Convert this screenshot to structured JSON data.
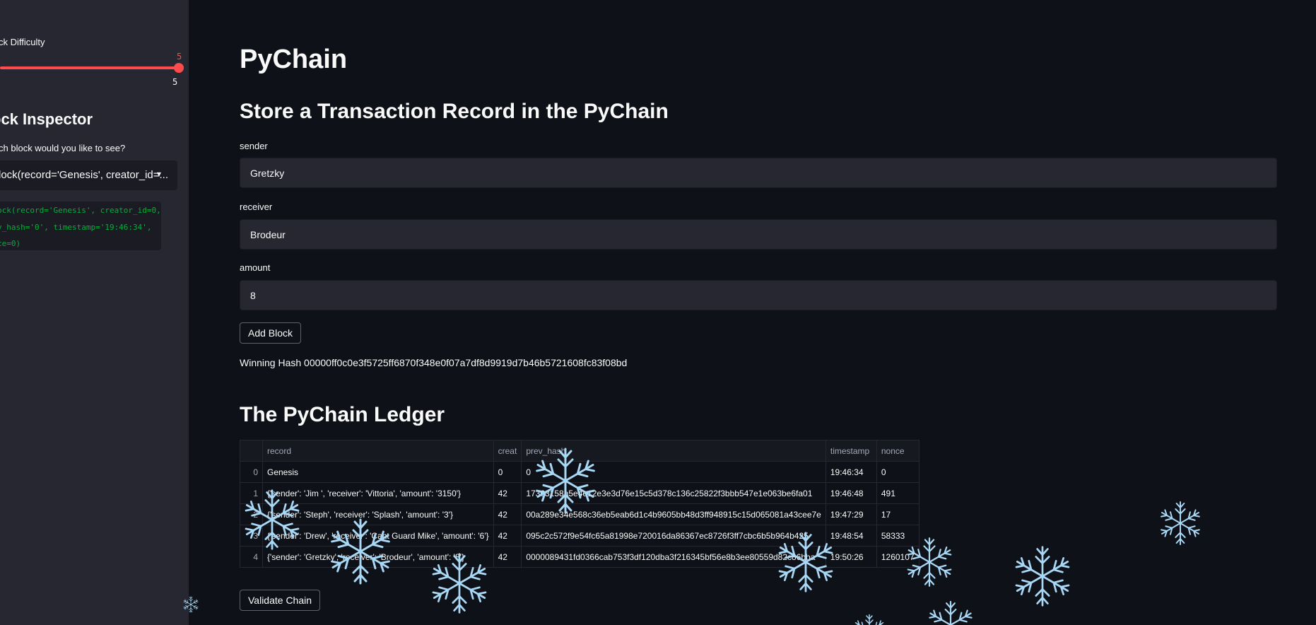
{
  "sidebar": {
    "difficulty_label": "ck Difficulty",
    "difficulty_value": "5",
    "difficulty_max": "5",
    "difficulty_fraction": 1.0,
    "inspector_heading": "ock Inspector",
    "inspector_question": "ch block would you like to see?",
    "selected_block": "lock(record='Genesis', creator_id=...",
    "block_detail_lines": [
      "ock(record='Genesis', creator_id=0,",
      "v_hash='0', timestamp='19:46:34',",
      "ce=0)"
    ]
  },
  "main": {
    "title": "PyChain",
    "form_heading": "Store a Transaction Record in the PyChain",
    "sender_label": "sender",
    "sender_value": "Gretzky",
    "receiver_label": "receiver",
    "receiver_value": "Brodeur",
    "amount_label": "amount",
    "amount_value": "8",
    "add_block_button": "Add Block",
    "winning_hash": "Winning Hash 00000ff0c0e3f5725ff6870f348e0f07a7df8d9919d7b46b5721608fc83f08bd",
    "ledger_heading": "The PyChain Ledger",
    "validate_button": "Validate Chain"
  },
  "ledger": {
    "columns": [
      "",
      "record",
      "creat",
      "prev_hash",
      "timestamp",
      "nonce"
    ],
    "rows": [
      [
        "0",
        "Genesis",
        "0",
        "0",
        "19:46:34",
        "0"
      ],
      [
        "1",
        "{'sender': 'Jim ', 'receiver': 'Vittoria', 'amount': '3150'}",
        "42",
        "17363158a5e4e12e3e3d76e15c5d378c136c25822f3bbb547e1e063be6fa01",
        "19:46:48",
        "491"
      ],
      [
        "2",
        "{'sender': 'Steph', 'receiver': 'Splash', 'amount': '3'}",
        "42",
        "00a289e34e568c36eb5eab6d1c4b9605bb48d3ff948915c15d065081a43cee7e",
        "19:47:29",
        "17"
      ],
      [
        "3",
        "{'sender': 'Drew', 'receiver': 'Cant Guard Mike', 'amount': '6'}",
        "42",
        "095c2c572f9e54fc65a81998e720016da86367ec8726f3ff7cbc6b5b964b425",
        "19:48:54",
        "58333"
      ],
      [
        "4",
        "{'sender': 'Gretzky', 'receiver': 'Brodeur', 'amount': '8'}",
        "42",
        "0000089431fd0366cab753f3df120dba3f216345bf56e8b3ee80559d82c86bba",
        "19:50:26",
        "1260107"
      ]
    ]
  },
  "colors": {
    "background": "#0e1117",
    "sidebar": "#262730",
    "accent": "#ff4b4b",
    "code_text": "#09ab3b",
    "snowflake": "#a8d8f5"
  },
  "icons": {
    "select_chevron": "chevron-down-icon",
    "decoration": "snowflake-icon"
  }
}
